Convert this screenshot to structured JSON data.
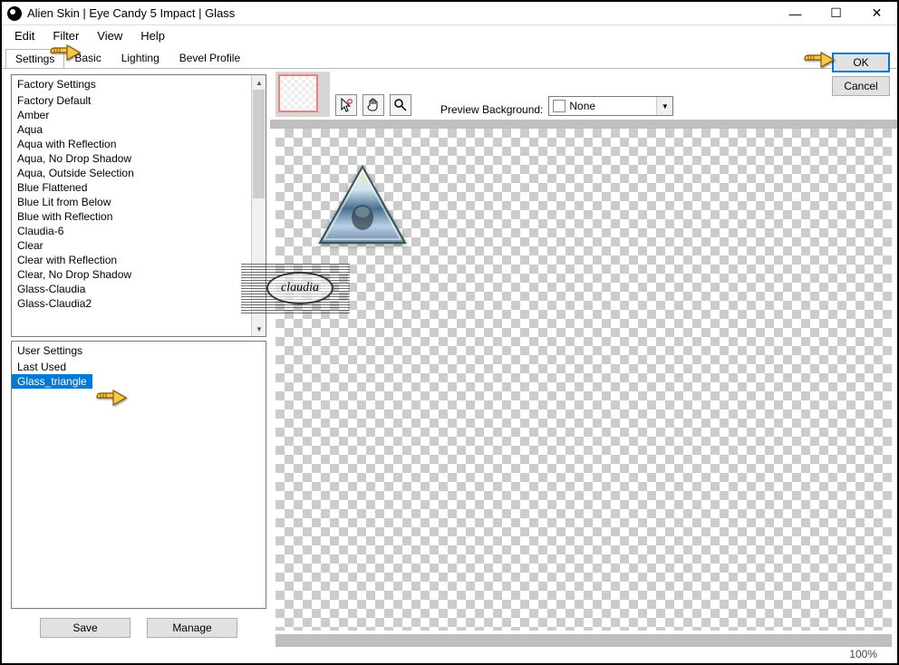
{
  "window": {
    "title": "Alien Skin | Eye Candy 5 Impact | Glass"
  },
  "menu": {
    "edit": "Edit",
    "filter": "Filter",
    "view": "View",
    "help": "Help"
  },
  "tabs": {
    "settings": "Settings",
    "basic": "Basic",
    "lighting": "Lighting",
    "bevel": "Bevel Profile"
  },
  "factory": {
    "header": "Factory Settings",
    "items": [
      "Factory Default",
      "Amber",
      "Aqua",
      "Aqua with Reflection",
      "Aqua, No Drop Shadow",
      "Aqua, Outside Selection",
      "Blue Flattened",
      "Blue Lit from Below",
      "Blue with Reflection",
      "Claudia-6",
      "Clear",
      "Clear with Reflection",
      "Clear, No Drop Shadow",
      "Glass-Claudia",
      "Glass-Claudia2"
    ]
  },
  "user": {
    "header": "User Settings",
    "items": [
      "Last Used",
      "Glass_triangle"
    ],
    "selected_index": 1
  },
  "buttons": {
    "save": "Save",
    "manage": "Manage",
    "ok": "OK",
    "cancel": "Cancel"
  },
  "preview": {
    "label": "Preview Background:",
    "value": "None"
  },
  "watermark": "claudia",
  "status": {
    "zoom": "100%"
  }
}
